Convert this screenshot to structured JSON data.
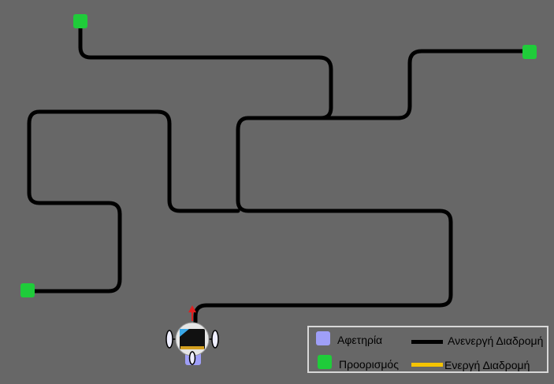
{
  "colors": {
    "background": "#676767",
    "inactive_path": "#000000",
    "active_path": "#f5c400",
    "start": "#9f9ff8",
    "destination": "#1fcc3a"
  },
  "legend": {
    "start_label": "Αφετηρία",
    "destination_label": "Προορισμός",
    "inactive_label": "Ανενεργή Διαδρομή",
    "active_label": "Ενεργή Διαδρομή"
  },
  "robot": {
    "icon": "microbit-robot-icon",
    "heading": "up"
  }
}
